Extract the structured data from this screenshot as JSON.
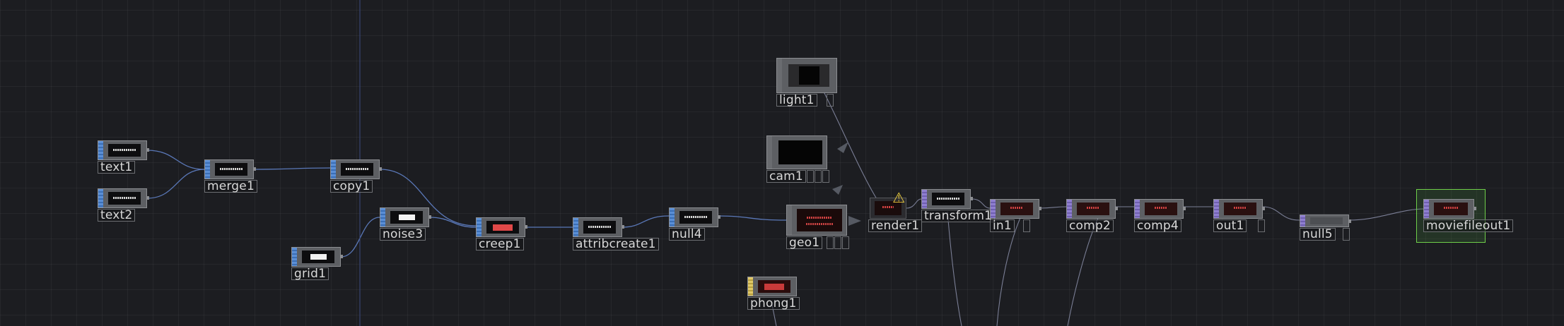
{
  "network": {
    "nodes": [
      {
        "id": "text1",
        "label": "text1"
      },
      {
        "id": "text2",
        "label": "text2"
      },
      {
        "id": "merge1",
        "label": "merge1"
      },
      {
        "id": "copy1",
        "label": "copy1"
      },
      {
        "id": "noise3",
        "label": "noise3"
      },
      {
        "id": "grid1",
        "label": "grid1"
      },
      {
        "id": "creep1",
        "label": "creep1"
      },
      {
        "id": "attribcreate1",
        "label": "attribcreate1"
      },
      {
        "id": "null4",
        "label": "null4"
      },
      {
        "id": "light1",
        "label": "light1"
      },
      {
        "id": "cam1",
        "label": "cam1"
      },
      {
        "id": "geo1",
        "label": "geo1"
      },
      {
        "id": "phong1",
        "label": "phong1"
      },
      {
        "id": "render1",
        "label": "render1"
      },
      {
        "id": "transform1",
        "label": "transform1"
      },
      {
        "id": "in1",
        "label": "in1"
      },
      {
        "id": "comp2",
        "label": "comp2"
      },
      {
        "id": "comp4",
        "label": "comp4"
      },
      {
        "id": "out1",
        "label": "out1"
      },
      {
        "id": "null5",
        "label": "null5"
      },
      {
        "id": "moviefileout1",
        "label": "moviefileout1"
      }
    ],
    "render1_warning_icon": "warning-icon",
    "colors": {
      "background": "#1c1d21",
      "sop_family": "#5b8fd6",
      "top_family": "#8f7fd0",
      "mat_family": "#e0c868",
      "wire": "#5a78b8",
      "selected_frame": "#6fcf4a",
      "warning": "#f0d040"
    }
  }
}
